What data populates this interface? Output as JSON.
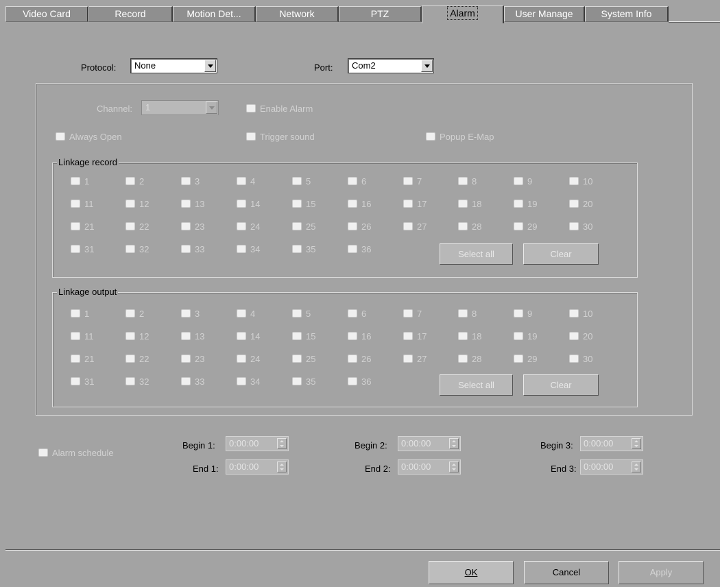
{
  "tabs": [
    {
      "label": "Video Card",
      "active": false
    },
    {
      "label": "Record",
      "active": false
    },
    {
      "label": "Motion Det...",
      "active": false
    },
    {
      "label": "Network",
      "active": false
    },
    {
      "label": "PTZ",
      "active": false
    },
    {
      "label": "Alarm",
      "active": true
    },
    {
      "label": "User Manage",
      "active": false
    },
    {
      "label": "System Info",
      "active": false
    }
  ],
  "protocol": {
    "label": "Protocol:",
    "value": "None"
  },
  "port": {
    "label": "Port:",
    "value": "Com2"
  },
  "channel": {
    "label": "Channel:",
    "value": "1"
  },
  "options": {
    "enable_alarm": "Enable Alarm",
    "always_open": "Always Open",
    "trigger_sound": "Trigger sound",
    "popup_emap": "Popup E-Map"
  },
  "linkage_record": {
    "title": "Linkage record",
    "channels": [
      "1",
      "2",
      "3",
      "4",
      "5",
      "6",
      "7",
      "8",
      "9",
      "10",
      "11",
      "12",
      "13",
      "14",
      "15",
      "16",
      "17",
      "18",
      "19",
      "20",
      "21",
      "22",
      "23",
      "24",
      "25",
      "26",
      "27",
      "28",
      "29",
      "30",
      "31",
      "32",
      "33",
      "34",
      "35",
      "36"
    ],
    "select_all": "Select all",
    "clear": "Clear"
  },
  "linkage_output": {
    "title": "Linkage output",
    "channels": [
      "1",
      "2",
      "3",
      "4",
      "5",
      "6",
      "7",
      "8",
      "9",
      "10",
      "11",
      "12",
      "13",
      "14",
      "15",
      "16",
      "17",
      "18",
      "19",
      "20",
      "21",
      "22",
      "23",
      "24",
      "25",
      "26",
      "27",
      "28",
      "29",
      "30",
      "31",
      "32",
      "33",
      "34",
      "35",
      "36"
    ],
    "select_all": "Select all",
    "clear": "Clear"
  },
  "schedule": {
    "label": "Alarm schedule",
    "slots": [
      {
        "begin_label": "Begin 1:",
        "begin": "0:00:00",
        "end_label": "End 1:",
        "end": "0:00:00"
      },
      {
        "begin_label": "Begin 2:",
        "begin": "0:00:00",
        "end_label": "End 2:",
        "end": "0:00:00"
      },
      {
        "begin_label": "Begin 3:",
        "begin": "0:00:00",
        "end_label": "End 3:",
        "end": "0:00:00"
      }
    ]
  },
  "buttons": {
    "ok": "OK",
    "cancel": "Cancel",
    "apply": "Apply"
  }
}
